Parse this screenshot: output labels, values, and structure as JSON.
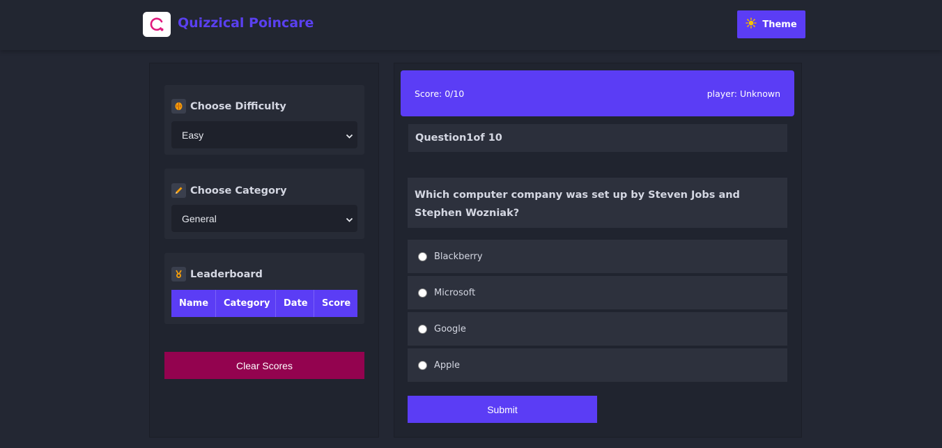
{
  "header": {
    "app_title": "Quizzical Poincare",
    "theme_label": "Theme",
    "logo_icon": "q-logo-icon",
    "theme_icon": "sun-icon"
  },
  "sidebar": {
    "difficulty": {
      "title": "Choose Difficulty",
      "icon": "brain-icon",
      "selected": "Easy"
    },
    "category": {
      "title": "Choose Category",
      "icon": "pencil-icon",
      "selected": "General"
    },
    "leaderboard": {
      "title": "Leaderboard",
      "icon": "medal-icon",
      "columns": [
        "Name",
        "Category",
        "Date",
        "Score"
      ]
    },
    "clear_label": "Clear Scores"
  },
  "quiz": {
    "score_text": "Score: 0/10",
    "player_text": "player: Unknown",
    "question_number": "Question1of 10",
    "question_text": "Which computer company was set up by Steven Jobs and Stephen Wozniak?",
    "options": [
      "Blackberry",
      "Microsoft",
      "Google",
      "Apple"
    ],
    "submit_label": "Submit"
  },
  "colors": {
    "accent": "#5b3df5",
    "danger": "#93034f",
    "background": "#232733"
  }
}
